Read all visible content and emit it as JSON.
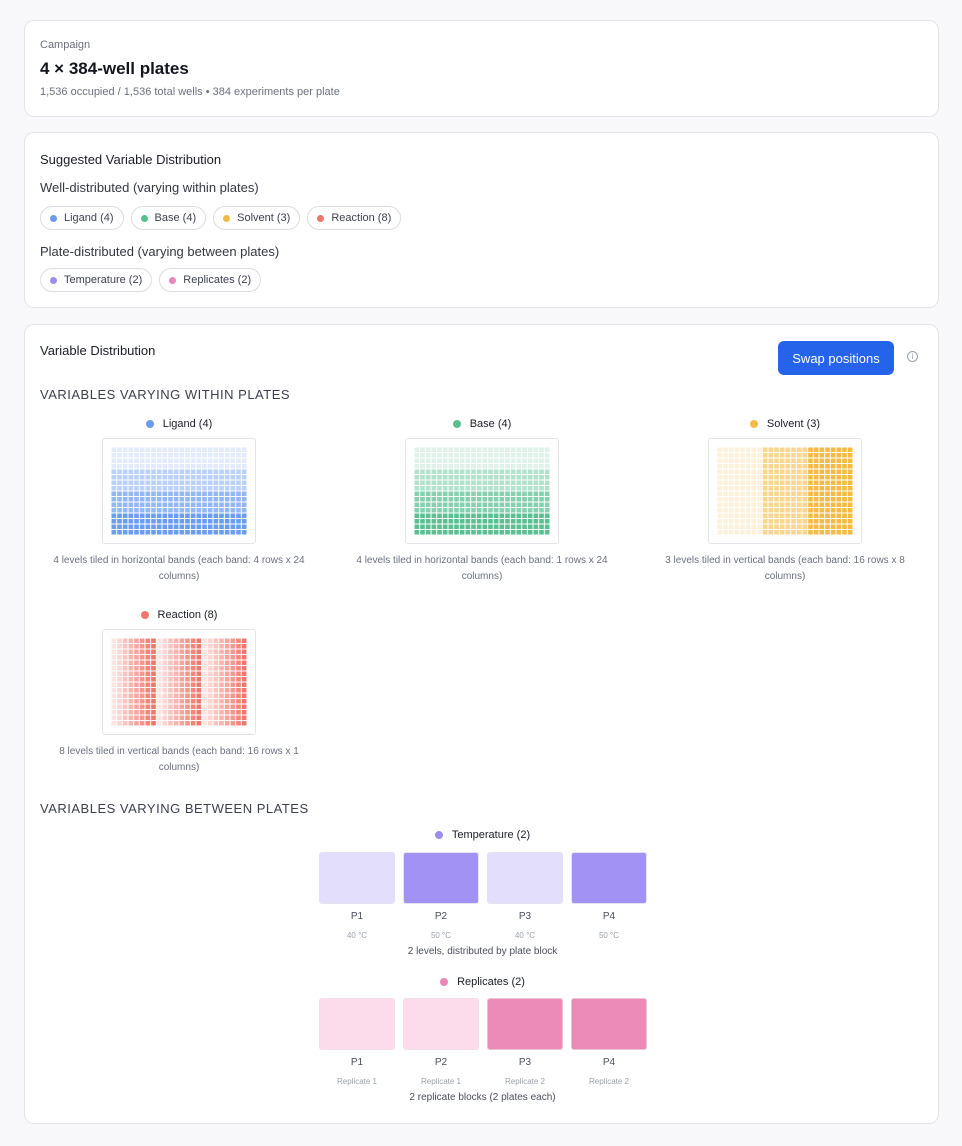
{
  "campaign": {
    "label": "Campaign",
    "title": "4 × 384-well plates",
    "subtitle": "1,536 occupied / 1,536 total wells • 384 experiments per plate"
  },
  "suggested": {
    "title": "Suggested Variable Distribution",
    "well_group_label": "Well-distributed (varying within plates)",
    "well_chips": [
      {
        "label": "Ligand (4)",
        "color": "#6b9cf0"
      },
      {
        "label": "Base (4)",
        "color": "#5bbf92"
      },
      {
        "label": "Solvent (3)",
        "color": "#f3bb45"
      },
      {
        "label": "Reaction (8)",
        "color": "#f0776b"
      }
    ],
    "plate_group_label": "Plate-distributed (varying between plates)",
    "plate_chips": [
      {
        "label": "Temperature (2)",
        "color": "#9b8ef0"
      },
      {
        "label": "Replicates (2)",
        "color": "#ea86b8"
      }
    ]
  },
  "distribution": {
    "title": "Variable Distribution",
    "swap_label": "Swap positions",
    "info_glyph": "i",
    "within_heading": "VARIABLES VARYING WITHIN PLATES",
    "between_heading": "VARIABLES VARYING BETWEEN PLATES",
    "within": [
      {
        "name": "Ligand (4)",
        "color": "#6b9cf0",
        "description": "4 levels tiled in horizontal bands (each band: 4 rows x 24 columns)",
        "pattern": "horizontal",
        "levels": 4
      },
      {
        "name": "Base (4)",
        "color": "#5bbf92",
        "description": "4 levels tiled in horizontal bands (each band: 1 rows x 24 columns)",
        "pattern": "horizontal",
        "levels": 4
      },
      {
        "name": "Solvent (3)",
        "color": "#f3bb45",
        "description": "3 levels tiled in vertical bands (each band: 16 rows x 8 columns)",
        "pattern": "vertical",
        "levels": 3
      },
      {
        "name": "Reaction (8)",
        "color": "#f0776b",
        "description": "8 levels tiled in vertical bands (each band: 16 rows x 1 columns)",
        "pattern": "vertical",
        "levels": 8
      }
    ],
    "between": [
      {
        "name": "Temperature (2)",
        "color": "#9b8ef0",
        "plates": [
          {
            "name": "P1",
            "value": "40 °C",
            "fill": "#e3defc"
          },
          {
            "name": "P2",
            "value": "50 °C",
            "fill": "#a292f3"
          },
          {
            "name": "P3",
            "value": "40 °C",
            "fill": "#e3defc"
          },
          {
            "name": "P4",
            "value": "50 °C",
            "fill": "#a292f3"
          }
        ],
        "note": "2 levels, distributed by plate block"
      },
      {
        "name": "Replicates (2)",
        "color": "#ea86b8",
        "plates": [
          {
            "name": "P1",
            "value": "Replicate 1",
            "fill": "#fcdbea"
          },
          {
            "name": "P2",
            "value": "Replicate 1",
            "fill": "#fcdbea"
          },
          {
            "name": "P3",
            "value": "Replicate 2",
            "fill": "#ec8ab8"
          },
          {
            "name": "P4",
            "value": "Replicate 2",
            "fill": "#ec8ab8"
          }
        ],
        "note": "2 replicate blocks (2 plates each)"
      }
    ]
  }
}
